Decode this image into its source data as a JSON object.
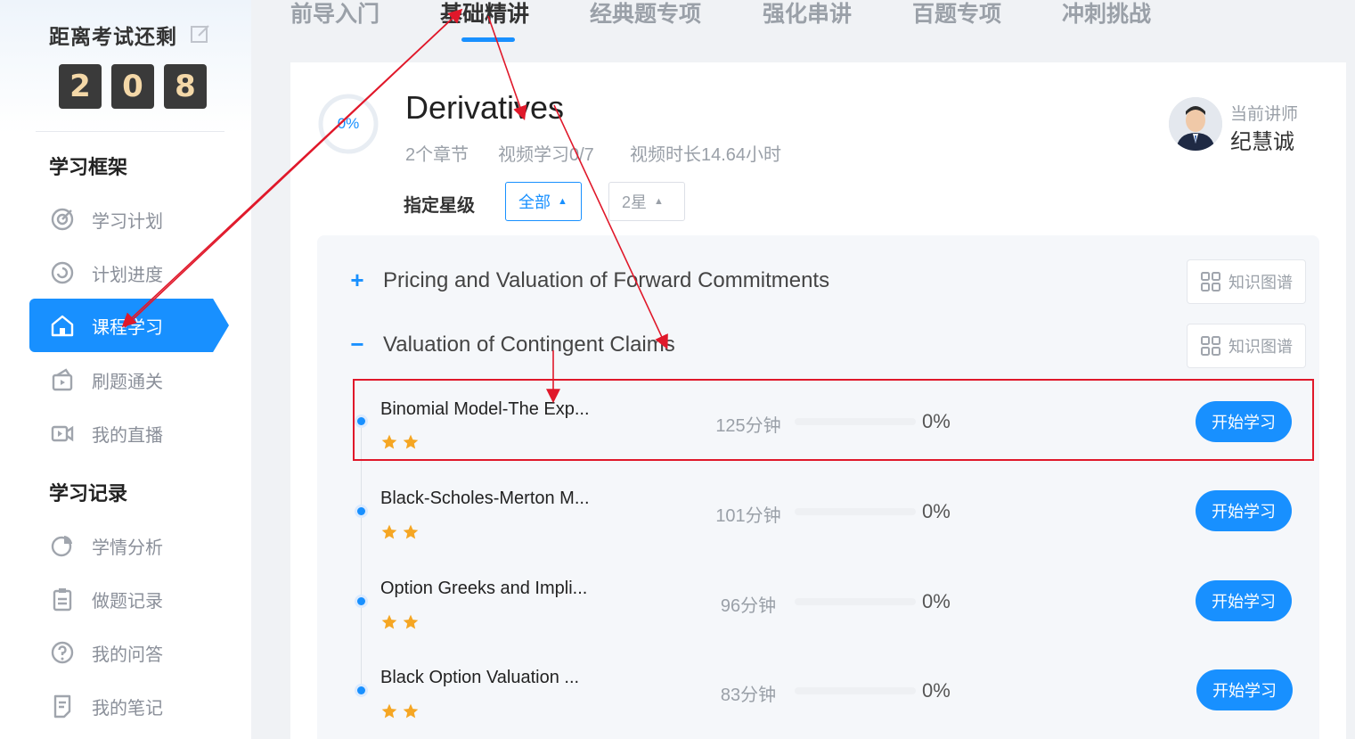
{
  "sidebar": {
    "countdown_title": "距离考试还剩",
    "countdown_digits": [
      "2",
      "0",
      "8"
    ],
    "section_framework": "学习框架",
    "section_records": "学习记录",
    "framework_items": [
      {
        "label": "学习计划",
        "icon": "target-icon"
      },
      {
        "label": "计划进度",
        "icon": "progress-circle-icon"
      },
      {
        "label": "课程学习",
        "icon": "home-icon",
        "active": true
      },
      {
        "label": "刷题通关",
        "icon": "practice-icon"
      },
      {
        "label": "我的直播",
        "icon": "video-icon"
      }
    ],
    "record_items": [
      {
        "label": "学情分析",
        "icon": "pie-chart-icon"
      },
      {
        "label": "做题记录",
        "icon": "clipboard-icon"
      },
      {
        "label": "我的问答",
        "icon": "question-icon"
      },
      {
        "label": "我的笔记",
        "icon": "notes-icon"
      }
    ]
  },
  "tabs": [
    {
      "label": "前导入门"
    },
    {
      "label": "基础精讲",
      "active": true
    },
    {
      "label": "经典题专项"
    },
    {
      "label": "强化串讲"
    },
    {
      "label": "百题专项"
    },
    {
      "label": "冲刺挑战"
    }
  ],
  "course": {
    "progress_text": "0%",
    "progress_value": 0,
    "title": "Derivatives",
    "chapters_count": "2个章节",
    "video_progress": "视频学习0/7",
    "video_duration": "视频时长14.64小时",
    "teacher_label": "当前讲师",
    "teacher_name": "纪慧诚",
    "star_filter_label": "指定星级",
    "filters": [
      {
        "label": "全部",
        "active": true
      },
      {
        "label": "2星",
        "active": false
      }
    ]
  },
  "chapters": [
    {
      "toggle": "+",
      "title": "Pricing and Valuation of Forward Commitments",
      "kg_label": "知识图谱"
    },
    {
      "toggle": "−",
      "title": "Valuation of Contingent Claims",
      "kg_label": "知识图谱"
    }
  ],
  "lessons": [
    {
      "title": "Binomial Model-The Exp...",
      "stars": 2,
      "duration": "125分钟",
      "percent": "0%",
      "progress": 0,
      "button": "开始学习"
    },
    {
      "title": "Black-Scholes-Merton M...",
      "stars": 2,
      "duration": "101分钟",
      "percent": "0%",
      "progress": 0,
      "button": "开始学习"
    },
    {
      "title": "Option Greeks and Impli...",
      "stars": 2,
      "duration": "96分钟",
      "percent": "0%",
      "progress": 0,
      "button": "开始学习"
    },
    {
      "title": "Black Option Valuation ...",
      "stars": 2,
      "duration": "83分钟",
      "percent": "0%",
      "progress": 0,
      "button": "开始学习"
    }
  ],
  "colors": {
    "accent": "#1890ff",
    "annotation": "#e0182a",
    "star": "#f5a623",
    "digit_bg": "#3a3a3a",
    "digit_fg": "#f4d8a8"
  }
}
